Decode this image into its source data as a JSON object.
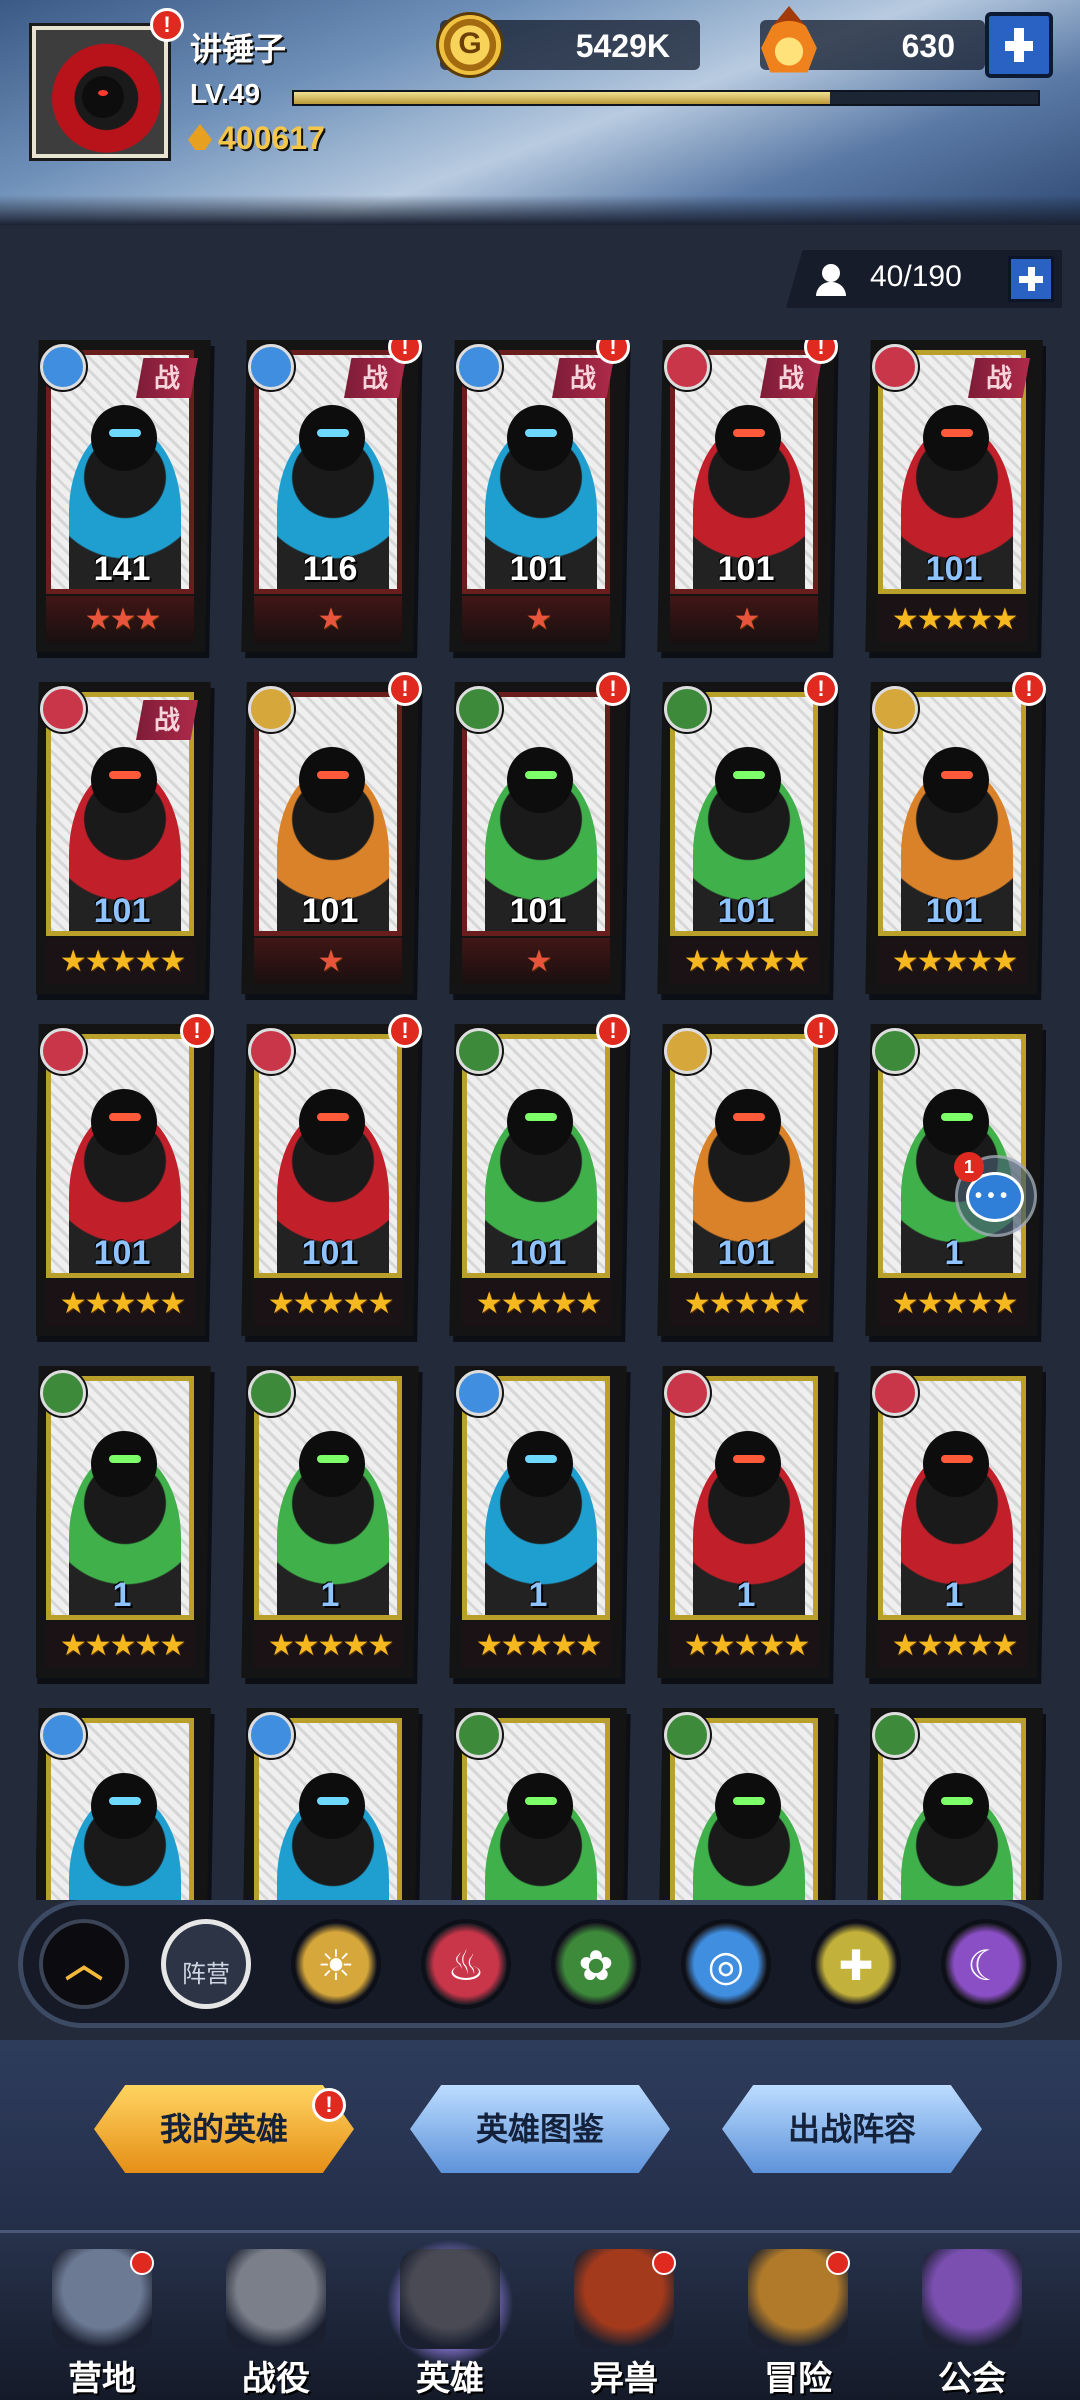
{
  "player": {
    "name": "讲锤子",
    "level": "LV.49",
    "xp_fraction": 0.72,
    "power": "400617"
  },
  "resources": {
    "gold": "5429K",
    "gems": "630"
  },
  "roster": {
    "capacity": "40/190"
  },
  "heroes": [
    {
      "level": "141",
      "stars": 3,
      "element": "water",
      "war": "战",
      "alert": false,
      "frame": "red"
    },
    {
      "level": "116",
      "stars": 1,
      "element": "water",
      "war": "战",
      "alert": true,
      "frame": "red"
    },
    {
      "level": "101",
      "stars": 1,
      "element": "water",
      "war": "战",
      "alert": true,
      "frame": "red"
    },
    {
      "level": "101",
      "stars": 1,
      "element": "fire",
      "war": "战",
      "alert": true,
      "frame": "red"
    },
    {
      "level": "101",
      "stars": 5,
      "element": "fire",
      "war": "战",
      "alert": false,
      "frame": "gold"
    },
    {
      "level": "101",
      "stars": 5,
      "element": "fire",
      "war": "战",
      "alert": false,
      "frame": "gold"
    },
    {
      "level": "101",
      "stars": 1,
      "element": "light",
      "war": "",
      "alert": true,
      "frame": "red"
    },
    {
      "level": "101",
      "stars": 1,
      "element": "nature",
      "war": "",
      "alert": true,
      "frame": "red"
    },
    {
      "level": "101",
      "stars": 5,
      "element": "nature",
      "war": "",
      "alert": true,
      "frame": "gold"
    },
    {
      "level": "101",
      "stars": 5,
      "element": "light",
      "war": "",
      "alert": true,
      "frame": "gold"
    },
    {
      "level": "101",
      "stars": 5,
      "element": "fire",
      "war": "",
      "alert": true,
      "frame": "gold"
    },
    {
      "level": "101",
      "stars": 5,
      "element": "fire",
      "war": "",
      "alert": true,
      "frame": "gold"
    },
    {
      "level": "101",
      "stars": 5,
      "element": "nature",
      "war": "",
      "alert": true,
      "frame": "gold"
    },
    {
      "level": "101",
      "stars": 5,
      "element": "light",
      "war": "",
      "alert": true,
      "frame": "gold"
    },
    {
      "level": "1",
      "stars": 5,
      "element": "nature",
      "war": "",
      "alert": false,
      "frame": "gold"
    },
    {
      "level": "1",
      "stars": 5,
      "element": "nature",
      "war": "",
      "alert": false,
      "frame": "gold"
    },
    {
      "level": "1",
      "stars": 5,
      "element": "nature",
      "war": "",
      "alert": false,
      "frame": "gold"
    },
    {
      "level": "1",
      "stars": 5,
      "element": "water",
      "war": "",
      "alert": false,
      "frame": "gold"
    },
    {
      "level": "1",
      "stars": 5,
      "element": "fire",
      "war": "",
      "alert": false,
      "frame": "gold"
    },
    {
      "level": "1",
      "stars": 5,
      "element": "fire",
      "war": "",
      "alert": false,
      "frame": "gold"
    },
    {
      "level": "",
      "stars": 0,
      "element": "water",
      "war": "",
      "alert": false,
      "frame": "gold"
    },
    {
      "level": "",
      "stars": 0,
      "element": "water",
      "war": "",
      "alert": false,
      "frame": "gold"
    },
    {
      "level": "",
      "stars": 0,
      "element": "nature",
      "war": "",
      "alert": false,
      "frame": "gold"
    },
    {
      "level": "",
      "stars": 0,
      "element": "nature",
      "war": "",
      "alert": false,
      "frame": "gold"
    },
    {
      "level": "",
      "stars": 0,
      "element": "nature",
      "war": "",
      "alert": false,
      "frame": "gold"
    }
  ],
  "chat": {
    "unread": "1"
  },
  "filters": {
    "camp_label": "阵营",
    "elements": [
      "light",
      "fire",
      "nature",
      "water",
      "holy",
      "arcane"
    ]
  },
  "tabs": {
    "my_heroes": "我的英雄",
    "hero_guide": "英雄图鉴",
    "battle_lineup": "出战阵容"
  },
  "nav": [
    {
      "label": "营地",
      "dot": true
    },
    {
      "label": "战役",
      "dot": false
    },
    {
      "label": "英雄",
      "dot": false
    },
    {
      "label": "异兽",
      "dot": true
    },
    {
      "label": "冒险",
      "dot": true
    },
    {
      "label": "公会",
      "dot": false
    }
  ],
  "colors": {
    "water": "#3f8ee0",
    "fire": "#c9364a",
    "nature": "#3c8a3a",
    "light": "#d6a73a",
    "holy": "#c2b13a",
    "arcane": "#8b4fc5"
  }
}
